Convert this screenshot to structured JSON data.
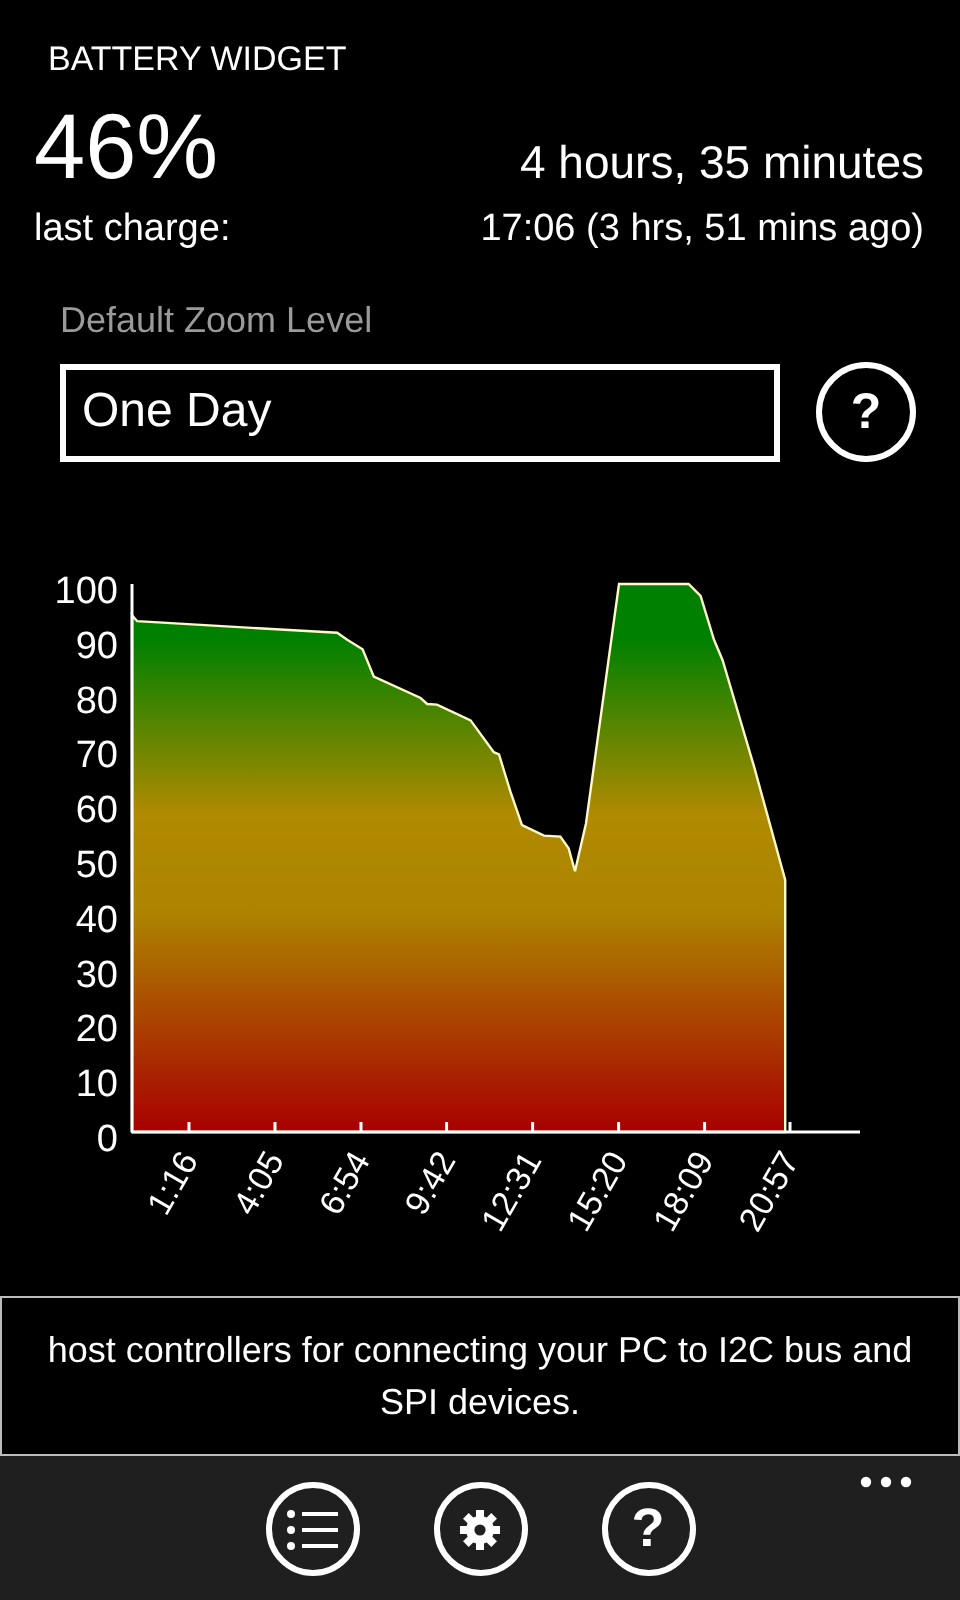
{
  "app_title": "BATTERY WIDGET",
  "percent": "46%",
  "remaining": "4 hours, 35 minutes",
  "last_charge_label": "last charge:",
  "last_charge_value": "17:06 (3 hrs, 51 mins ago)",
  "zoom": {
    "label": "Default Zoom Level",
    "value": "One Day",
    "help": "?"
  },
  "chart_data": {
    "type": "area",
    "xlim": [
      -0.6,
      23.24
    ],
    "ylim": [
      0,
      100
    ],
    "x": [
      -0.6,
      -0.43,
      6.12,
      6.45,
      6.95,
      7.32,
      8.85,
      9.07,
      9.39,
      10.49,
      11.25,
      11.42,
      11.8,
      12.17,
      12.89,
      13.43,
      13.7,
      13.91,
      14.27,
      15.35,
      17.63,
      18.02,
      18.46,
      18.74,
      19.77,
      20.13,
      20.79
    ],
    "series": [
      {
        "color": "#fff8c8",
        "values": [
          94.3,
          93.2,
          91.1,
          89.8,
          88.1,
          83.1,
          79.2,
          78.1,
          78,
          75.1,
          69.3,
          68.9,
          62,
          56,
          54.1,
          53.9,
          51.8,
          47.6,
          56.3,
          100,
          100,
          97.8,
          89.8,
          86.1,
          66.7,
          59.4,
          46
        ]
      }
    ],
    "xticks": [
      {
        "value": 1.267,
        "label": "1:16"
      },
      {
        "value": 4.083,
        "label": "4:05"
      },
      {
        "value": 6.9,
        "label": "6:54"
      },
      {
        "value": 9.7,
        "label": "9:42"
      },
      {
        "value": 12.517,
        "label": "12:31"
      },
      {
        "value": 15.333,
        "label": "15:20"
      },
      {
        "value": 18.15,
        "label": "18:09"
      },
      {
        "value": 20.95,
        "label": "20:57"
      }
    ],
    "yticks": [
      0,
      10,
      20,
      30,
      40,
      50,
      60,
      70,
      80,
      90,
      100
    ]
  },
  "banner": {
    "text": "host controllers for connecting your PC to I2C bus and SPI devices."
  },
  "app_bar": {
    "buttons": [
      {
        "kind": "list"
      },
      {
        "kind": "settings"
      },
      {
        "kind": "help",
        "label": "?"
      }
    ]
  }
}
